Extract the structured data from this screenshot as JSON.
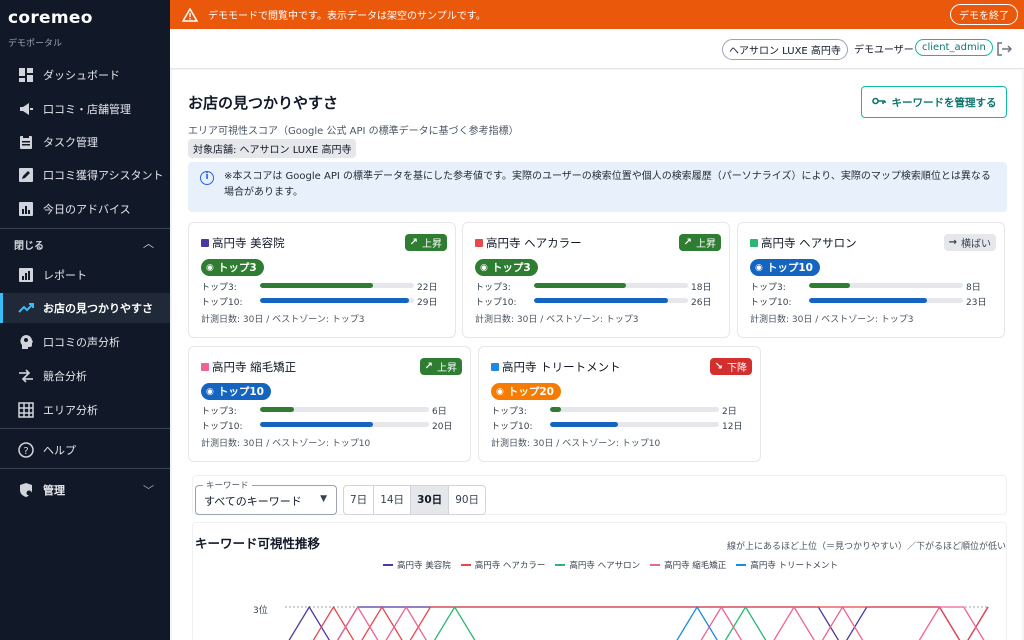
{
  "sidebar": {
    "brand": "coremeo",
    "subtitle": "デモポータル",
    "items": [
      {
        "label": "ダッシュボード",
        "icon": "dashboard-icon"
      },
      {
        "label": "口コミ・店舗管理",
        "icon": "megaphone-icon"
      },
      {
        "label": "タスク管理",
        "icon": "clipboard-icon"
      },
      {
        "label": "口コミ獲得アシスタント",
        "icon": "edit-icon"
      },
      {
        "label": "今日のアドバイス",
        "icon": "bar-chart-icon"
      }
    ],
    "section_label": "閉じる",
    "sub_items": [
      {
        "label": "レポート",
        "icon": "report-icon"
      },
      {
        "label": "お店の見つかりやすさ",
        "icon": "trending-up-icon"
      },
      {
        "label": "口コミの声分析",
        "icon": "head-icon"
      },
      {
        "label": "競合分析",
        "icon": "compare-icon"
      },
      {
        "label": "エリア分析",
        "icon": "grid-icon"
      }
    ],
    "help": "ヘルプ",
    "admin": "管理"
  },
  "banner": {
    "message": "デモモードで閲覧中です。表示データは架空のサンプルです。",
    "end_button": "デモを終了"
  },
  "topbar": {
    "store": "ヘアサロン LUXE 高円寺",
    "user_label": "デモユーザー",
    "role": "client_admin"
  },
  "page": {
    "title": "お店の見つかりやすさ",
    "manage_button": "キーワードを管理する",
    "subtitle": "エリア可視性スコア（Google 公式 API の標準データに基づく参考指標）",
    "store_chip": "対象店舗: ヘアサロン LUXE 高円寺",
    "info": "※本スコアは Google API の標準データを基にした参考値です。実際のユーザーの検索位置や個人の検索履歴（パーソナライズ）により、実際のマップ検索順位とは異なる場合があります。"
  },
  "labels": {
    "top3": "トップ3:",
    "top10": "トップ10:"
  },
  "keywords": [
    {
      "name": "高円寺 美容院",
      "color": "#4a3aa0",
      "trend": "上昇",
      "trend_type": "up",
      "zone": "トップ3",
      "zone_color": "#2e7d32",
      "top3_days": 22,
      "top10_days": 29,
      "top3_label": "22日",
      "top10_label": "29日",
      "footer": "計測日数: 30日 / ベストゾーン: トップ3"
    },
    {
      "name": "高円寺 ヘアカラー",
      "color": "#e5484d",
      "trend": "上昇",
      "trend_type": "up",
      "zone": "トップ3",
      "zone_color": "#2e7d32",
      "top3_days": 18,
      "top10_days": 26,
      "top3_label": "18日",
      "top10_label": "26日",
      "footer": "計測日数: 30日 / ベストゾーン: トップ3"
    },
    {
      "name": "高円寺 ヘアサロン",
      "color": "#2bb673",
      "trend": "横ばい",
      "trend_type": "flat",
      "zone": "トップ10",
      "zone_color": "#1565c0",
      "top3_days": 8,
      "top10_days": 23,
      "top3_label": "8日",
      "top10_label": "23日",
      "footer": "計測日数: 30日 / ベストゾーン: トップ3"
    },
    {
      "name": "高円寺 縮毛矯正",
      "color": "#f06292",
      "trend": "上昇",
      "trend_type": "up",
      "zone": "トップ10",
      "zone_color": "#1565c0",
      "top3_days": 6,
      "top10_days": 20,
      "top3_label": "6日",
      "top10_label": "20日",
      "footer": "計測日数: 30日 / ベストゾーン: トップ10"
    },
    {
      "name": "高円寺 トリートメント",
      "color": "#1e88e5",
      "trend": "下降",
      "trend_type": "down",
      "zone": "トップ20",
      "zone_color": "#f57c00",
      "top3_days": 2,
      "top10_days": 12,
      "top3_label": "2日",
      "top10_label": "12日",
      "footer": "計測日数: 30日 / ベストゾーン: トップ10"
    }
  ],
  "measured_days": 30,
  "filter": {
    "select_label": "キーワード",
    "select_value": "すべてのキーワード",
    "periods": [
      "7日",
      "14日",
      "30日",
      "90日"
    ],
    "active_period": "30日"
  },
  "chart": {
    "title": "キーワード可視性推移",
    "note": "線が上にあるほど上位（＝見つかりやすい）／下がるほど順位が低い",
    "y_tick": "3位"
  },
  "chart_data": {
    "type": "line",
    "title": "キーワード可視性推移",
    "y_tick_labels": [
      "3位"
    ],
    "series": [
      {
        "name": "高円寺 美容院",
        "color": "#4a3aa0",
        "values": [
          4,
          3,
          4,
          3,
          3,
          3,
          3,
          3,
          3,
          3,
          3,
          3,
          3,
          3,
          3,
          3,
          3,
          3,
          3,
          3,
          3,
          3,
          3,
          4,
          3,
          3,
          3,
          3,
          4,
          3
        ]
      },
      {
        "name": "高円寺 ヘアカラー",
        "color": "#e5484d",
        "values": [
          4,
          4,
          3,
          4,
          3,
          4,
          3,
          3,
          3,
          3,
          3,
          3,
          3,
          3,
          3,
          3,
          3,
          3,
          3,
          3,
          3,
          3,
          3,
          3,
          3,
          3,
          3,
          3,
          4,
          3
        ]
      },
      {
        "name": "高円寺 ヘアサロン",
        "color": "#2bb673",
        "values": [
          4,
          4,
          4,
          4,
          4,
          4,
          4,
          3,
          4,
          4,
          4,
          4,
          4,
          4,
          4,
          4,
          4,
          4,
          4,
          3,
          4,
          4,
          4,
          4,
          4,
          4,
          4,
          4,
          4,
          4
        ]
      },
      {
        "name": "高円寺 縮毛矯正",
        "color": "#f06292",
        "values": [
          4,
          4,
          4,
          3,
          4,
          3,
          4,
          4,
          4,
          4,
          4,
          4,
          4,
          4,
          4,
          4,
          4,
          4,
          3,
          4,
          4,
          3,
          4,
          3,
          4,
          4,
          4,
          3,
          3,
          4
        ]
      },
      {
        "name": "高円寺 トリートメント",
        "color": "#1e88e5",
        "values": [
          4,
          4,
          4,
          4,
          4,
          4,
          4,
          4,
          4,
          4,
          4,
          4,
          4,
          4,
          4,
          4,
          4,
          3,
          4,
          4,
          4,
          4,
          4,
          4,
          4,
          4,
          4,
          4,
          4,
          4
        ]
      }
    ]
  }
}
